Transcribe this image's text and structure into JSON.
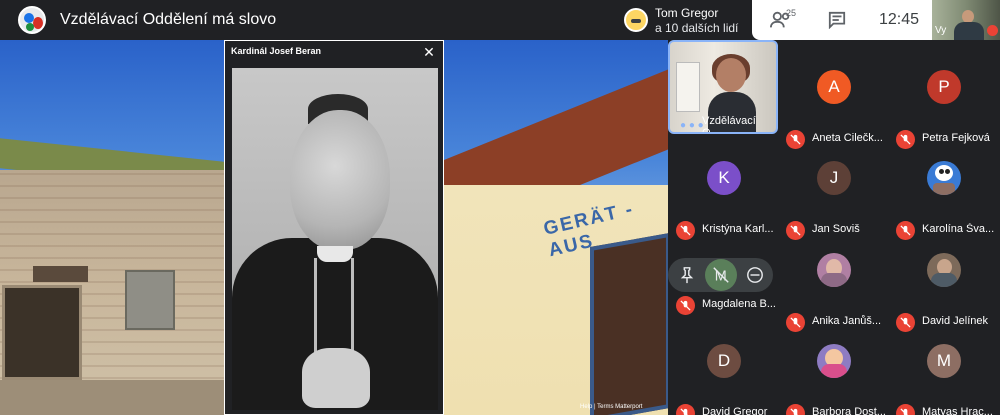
{
  "app": {
    "meeting_title": "Vzdělávací Oddělení má slovo",
    "presenter_name": "Tom Gregor",
    "presenter_subtitle": "a 10 dalších lidí",
    "participants_count": "25",
    "clock": "12:45",
    "self_label": "Vy"
  },
  "dialog": {
    "title": "Kardinál Josef Beran",
    "close_icon": "close-icon"
  },
  "stage": {
    "sign_text": "GERÄT - AUS",
    "credit": "Help | Terms  Matterport"
  },
  "participants": [
    {
      "name": "Vzdělávací O...",
      "type": "video"
    },
    {
      "name": "Aneta Cilečk...",
      "initial": "A",
      "color": "#f05a24"
    },
    {
      "name": "Petra Fejková",
      "initial": "P",
      "color": "#c0392b"
    },
    {
      "name": "Kristýna Karl...",
      "initial": "K",
      "color": "#7b4fc9"
    },
    {
      "name": "Jan Soviš",
      "initial": "J",
      "color": "#5d4037"
    },
    {
      "name": "Karolína Šva...",
      "type": "picture",
      "color": "#3a7bd5"
    },
    {
      "name": "Magdalena B...",
      "initial": "M",
      "color": "#5a7f5a"
    },
    {
      "name": "Anika Janůš...",
      "type": "picture",
      "color": "#b07fa3"
    },
    {
      "name": "David Jelínek",
      "type": "picture",
      "color": "#7d6a5a"
    },
    {
      "name": "David Gregor",
      "initial": "D",
      "color": "#6d4c41"
    },
    {
      "name": "Barbora Dost...",
      "type": "picture",
      "color": "#8e7cc3"
    },
    {
      "name": "Matyas Hrac...",
      "initial": "M",
      "color": "#8d6e63"
    }
  ]
}
